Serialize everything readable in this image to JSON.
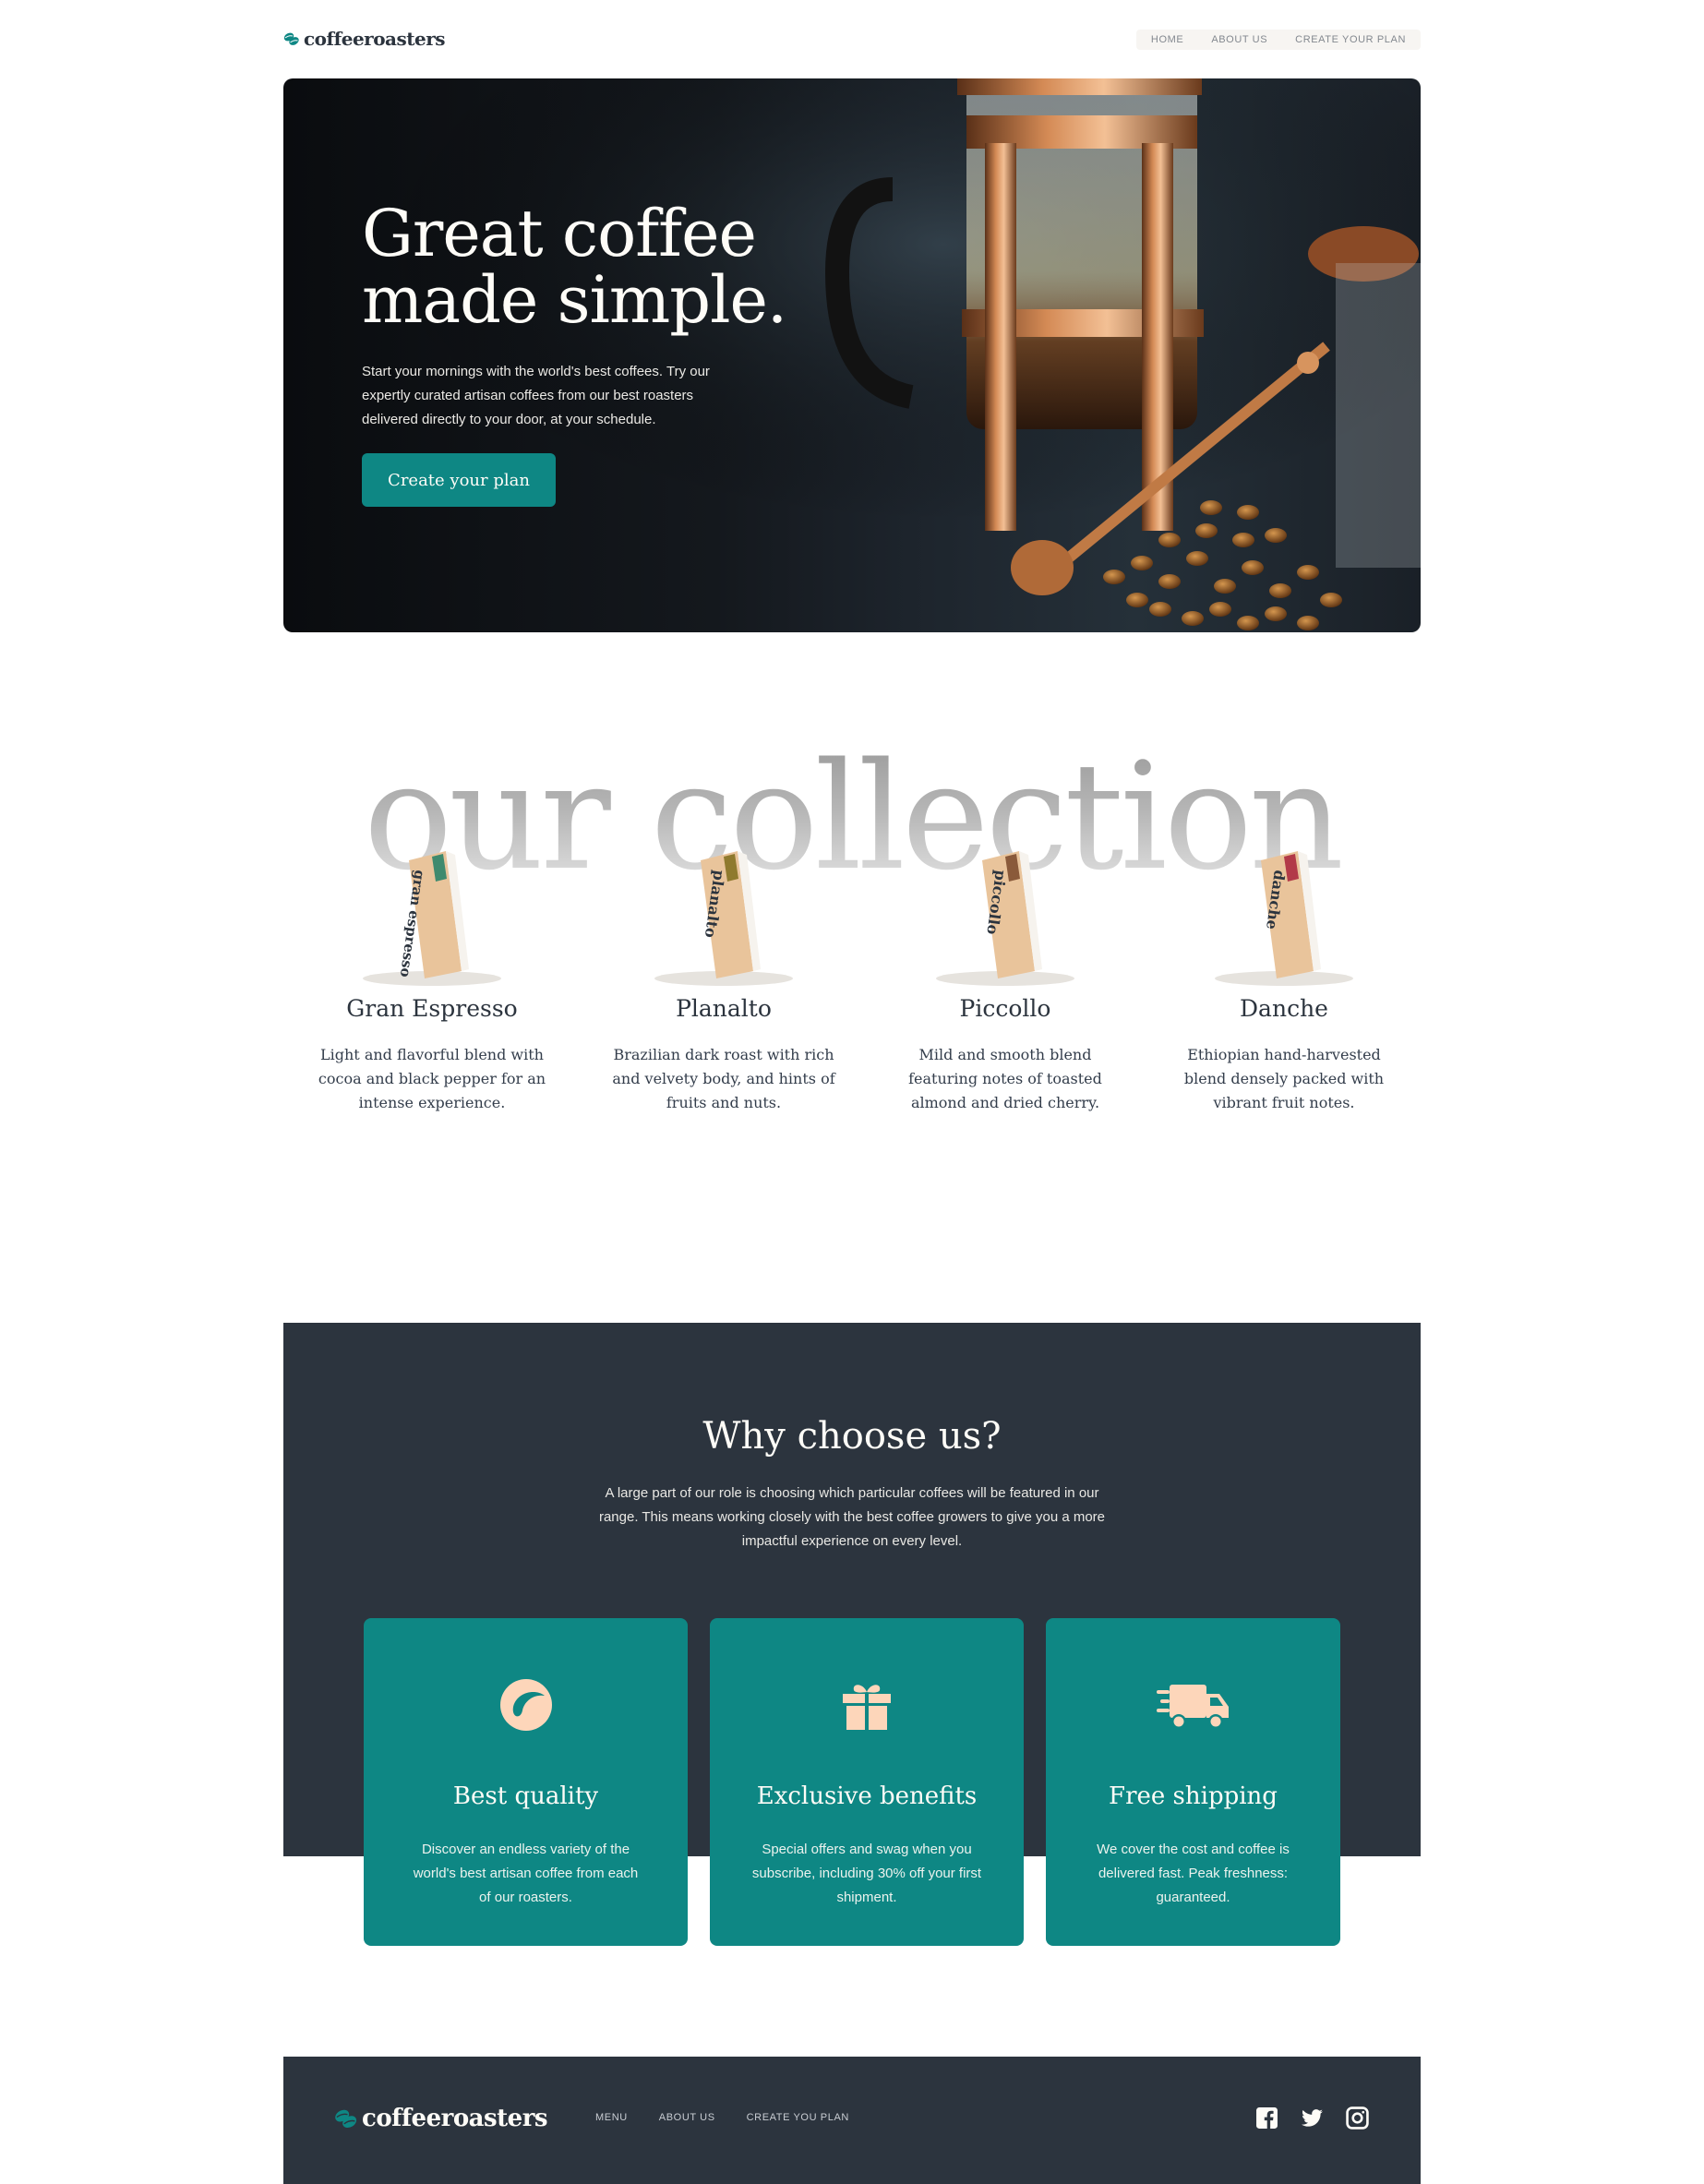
{
  "header": {
    "logo_text": "coffeeroasters",
    "nav": [
      "HOME",
      "ABOUT US",
      "CREATE YOUR PLAN"
    ]
  },
  "hero": {
    "title_line1": "Great coffee",
    "title_line2": "made simple.",
    "description": "Start your mornings with the world's best coffees. Try our expertly curated artisan coffees from our best roasters delivered directly to your door, at your schedule.",
    "cta_label": "Create your plan"
  },
  "collection": {
    "title": "our collection",
    "products": [
      {
        "name": "Gran Espresso",
        "bag_label": "gran espresso",
        "description": "Light and flavorful blend with cocoa and black pepper for an intense experience.",
        "accent": "#3f8a6e"
      },
      {
        "name": "Planalto",
        "bag_label": "planalto",
        "description": "Brazilian dark roast with rich and velvety body, and hints of fruits and nuts.",
        "accent": "#8f7a2e"
      },
      {
        "name": "Piccollo",
        "bag_label": "piccollo",
        "description": "Mild and smooth blend featuring notes of toasted almond and dried cherry.",
        "accent": "#8a5a3a"
      },
      {
        "name": "Danche",
        "bag_label": "danche",
        "description": "Ethiopian hand-harvested blend densely packed with vibrant fruit notes.",
        "accent": "#b23a48"
      }
    ]
  },
  "why": {
    "title": "Why choose us?",
    "intro": "A large part of our role is choosing which particular coffees will be featured in our range. This means working closely with the best coffee growers to give you a more impactful experience on every level.",
    "cards": [
      {
        "icon": "coffee-bean-icon",
        "title": "Best quality",
        "text": "Discover an endless variety of the world's best artisan coffee from each of our roasters."
      },
      {
        "icon": "gift-icon",
        "title": "Exclusive benefits",
        "text": "Special offers and swag when you subscribe, including 30% off your first shipment."
      },
      {
        "icon": "truck-icon",
        "title": "Free shipping",
        "text": "We cover the cost and coffee is delivered fast. Peak freshness: guaranteed."
      }
    ]
  },
  "footer": {
    "logo_text": "coffeeroasters",
    "nav": [
      "MENU",
      "ABOUT US",
      "CREATE YOU PLAN"
    ],
    "social": [
      "facebook-icon",
      "twitter-icon",
      "instagram-icon"
    ]
  },
  "colors": {
    "teal": "#0e8784",
    "dark": "#2c343e",
    "cream": "#fefcf7",
    "peach": "#fdd6ba"
  }
}
